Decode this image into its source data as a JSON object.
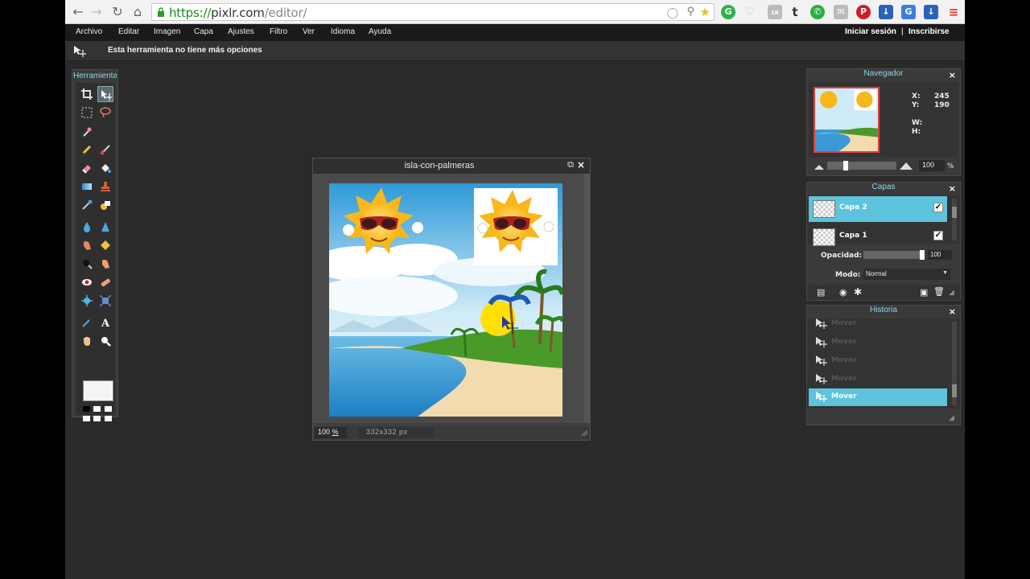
{
  "browser": {
    "url_scheme": "https://",
    "url_host": "pixlr.com",
    "url_path": "/editor/",
    "badge_count": "1K"
  },
  "menu": {
    "items": [
      "Archivo",
      "Editar",
      "Imagen",
      "Capa",
      "Ajustes",
      "Filtro",
      "Ver",
      "Idioma",
      "Ayuda"
    ],
    "login": "Iniciar sesión",
    "separator": "|",
    "signup": "Inscribirse"
  },
  "options_bar": {
    "text": "Esta herramienta no tiene más opciones"
  },
  "tools": {
    "title": "Herramientas"
  },
  "image_window": {
    "title": "isla-con-palmeras",
    "zoom": "100",
    "zoom_unit": "%",
    "dimensions": "332x332 px"
  },
  "navigator": {
    "title": "Navegador",
    "x_label": "X:",
    "x_value": "245",
    "y_label": "Y:",
    "y_value": "190",
    "w_label": "W:",
    "h_label": "H:",
    "zoom_value": "100",
    "zoom_unit": "%"
  },
  "layers": {
    "title": "Capas",
    "items": [
      {
        "name": "Capa 2",
        "selected": true,
        "visible": true
      },
      {
        "name": "Capa 1",
        "selected": false,
        "visible": true
      }
    ],
    "opacity_label": "Opacidad:",
    "opacity_value": "100",
    "mode_label": "Modo:",
    "mode_value": "Normal"
  },
  "history": {
    "title": "Historia",
    "items": [
      "Mover",
      "Mover",
      "Mover",
      "Mover",
      "Mover"
    ],
    "selected_index": 4
  },
  "colors": {
    "accent": "#5ec3dc",
    "panel_title": "#8fd6f0"
  }
}
